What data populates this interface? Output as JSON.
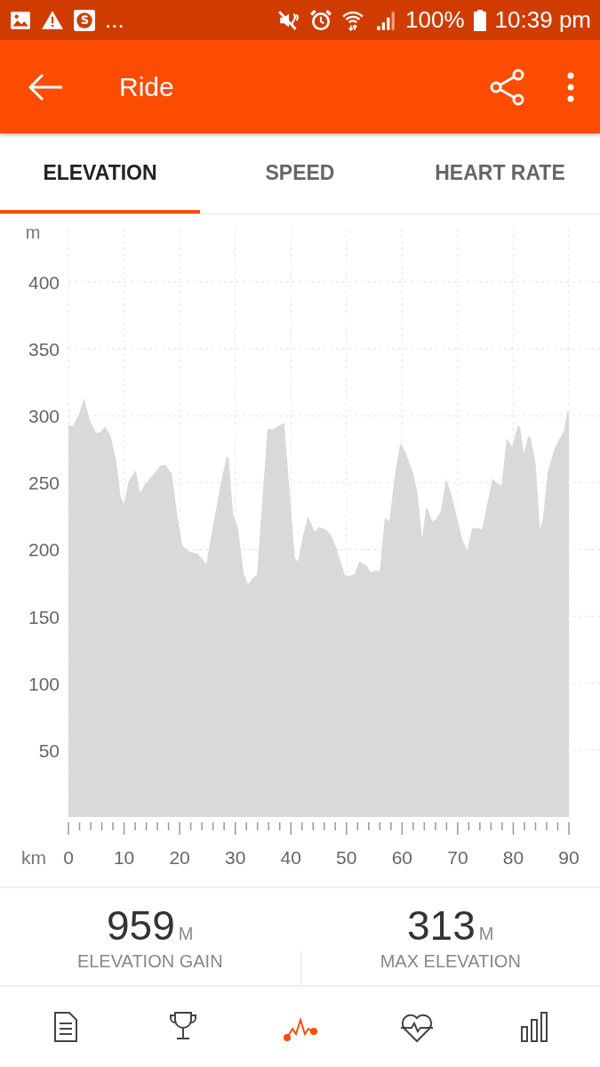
{
  "status_bar": {
    "left_icons": [
      {
        "kind": "image"
      },
      {
        "kind": "warning"
      },
      {
        "kind": "app"
      }
    ],
    "more": "...",
    "right_icons": [
      {
        "kind": "mute"
      },
      {
        "kind": "alarm"
      },
      {
        "kind": "wifi"
      },
      {
        "kind": "signal"
      }
    ],
    "battery": "100%",
    "time": "10:39 pm"
  },
  "app_bar": {
    "title": "Ride"
  },
  "tabs": [
    {
      "label": "ELEVATION",
      "selected": true
    },
    {
      "label": "SPEED",
      "selected": false
    },
    {
      "label": "HEART RATE",
      "selected": false
    }
  ],
  "chart": {
    "chart_data": {
      "type": "area",
      "ylabel": "m",
      "xlabel": "km",
      "grid": true,
      "xlim": [
        0,
        90
      ],
      "ylim": [
        0,
        440
      ],
      "xticks": [
        0,
        10,
        20,
        30,
        40,
        50,
        60,
        70,
        80,
        90
      ],
      "yticks": [
        50,
        100,
        150,
        200,
        250,
        300,
        350,
        400
      ],
      "x": [
        0,
        0.8,
        1.9,
        2.8,
        3.9,
        5,
        5.8,
        6.6,
        7.6,
        8.6,
        9.4,
        10,
        10.8,
        12.1,
        12.9,
        13.6,
        15.3,
        16.6,
        17.5,
        18.6,
        19.6,
        20.5,
        21.5,
        22.2,
        23.2,
        24.1,
        24.8,
        25.7,
        27.4,
        28.4,
        28.8,
        29.6,
        30.5,
        31.5,
        32.3,
        33.2,
        33.9,
        35.8,
        36.8,
        38.1,
        38.8,
        40.7,
        41.3,
        42.2,
        43.1,
        44.3,
        45,
        46.3,
        47.2,
        48.1,
        49.7,
        50.6,
        51.5,
        52.3,
        53.6,
        54.4,
        55.2,
        56,
        56.9,
        57.7,
        58.8,
        59.7,
        60.8,
        61.9,
        62.8,
        63.6,
        64.3,
        64.6,
        65.5,
        66.2,
        67,
        67.9,
        68.8,
        69.8,
        70.8,
        71.7,
        72.6,
        73.6,
        74.4,
        75.5,
        76.3,
        77.2,
        77.9,
        78.8,
        79.8,
        80.8,
        81.2,
        81.9,
        82.7,
        83.1,
        84,
        84.8,
        85.3,
        86.2,
        87.4,
        88.3,
        89.1,
        89.7,
        90
      ],
      "series": [
        {
          "color": "#d9d9d9",
          "values": [
            293,
            292,
            301,
            313,
            296,
            287,
            288,
            292,
            285,
            266,
            239,
            234,
            251,
            259,
            242,
            248,
            256,
            263,
            263,
            256,
            225,
            203,
            199,
            198,
            197,
            193,
            189,
            211,
            249,
            269,
            269,
            226,
            216,
            182,
            174,
            179,
            181,
            290,
            290,
            293,
            295,
            194,
            191,
            211,
            225,
            213,
            217,
            215,
            211,
            202,
            181,
            180,
            182,
            191,
            188,
            183,
            184,
            184,
            224,
            221,
            258,
            280,
            271,
            258,
            242,
            208,
            231,
            230,
            221,
            223,
            229,
            253,
            242,
            225,
            208,
            199,
            216,
            216,
            215,
            238,
            253,
            249,
            248,
            283,
            277,
            292,
            292,
            272,
            285,
            284,
            265,
            215,
            222,
            258,
            275,
            283,
            288,
            303,
            303
          ]
        }
      ]
    }
  },
  "stats": [
    {
      "value": "959",
      "unit": "M",
      "label": "ELEVATION GAIN"
    },
    {
      "value": "313",
      "unit": "M",
      "label": "MAX ELEVATION"
    }
  ],
  "bottom_nav": [
    {
      "kind": "summary",
      "selected": false
    },
    {
      "kind": "trophy",
      "selected": false
    },
    {
      "kind": "analysis",
      "selected": true
    },
    {
      "kind": "heart",
      "selected": false
    },
    {
      "kind": "stats",
      "selected": false
    }
  ]
}
